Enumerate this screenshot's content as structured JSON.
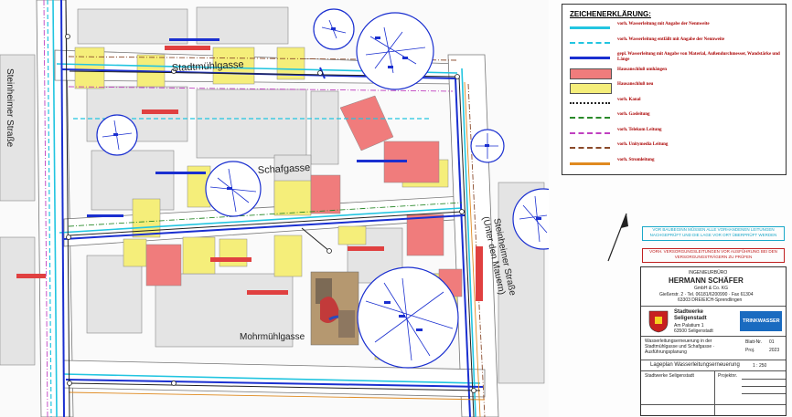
{
  "streets": {
    "stadtmuehlgasse": "Stadtmühlgasse",
    "schafgasse": "Schafgasse",
    "mohrmuehlgasse": "Mohrmühlgasse",
    "steinheimer_left": "Steinheimer Straße",
    "steinheimer_right": "Steinheimer Straße",
    "unter_den_mauern": "(Unter den Mauern)"
  },
  "legend": {
    "title": "ZEICHENERKLÄRUNG:",
    "items": [
      {
        "text": "vorh. Wasserleitung mit Angabe der Nennweite",
        "color": "#22c5e0",
        "style": "solid"
      },
      {
        "text": "vorh. Wasserleitung entfällt mit Angabe der Nennweite",
        "color": "#22c5e0",
        "style": "dashed"
      },
      {
        "text": "gepl. Wasserleitung mit Angabe von Material, Außendurchmesser, Wandstärke und Länge",
        "color": "#1a2fd0",
        "style": "solid"
      },
      {
        "text": "Hausanschluß umhängen",
        "color": "#f07c7c",
        "style": "box"
      },
      {
        "text": "Hausanschluß neu",
        "color": "#f5ee7a",
        "style": "box"
      },
      {
        "text": "vorh. Kanal",
        "color": "#222222",
        "style": "dots"
      },
      {
        "text": "vorh. Gasleitung",
        "color": "#2a8a2a",
        "style": "dashdot"
      },
      {
        "text": "vorh. Telekom Leitung",
        "color": "#c040c0",
        "style": "dashdot"
      },
      {
        "text": "vorh. Unitymedia Leitung",
        "color": "#8a4a2a",
        "style": "dashdot"
      },
      {
        "text": "vorh. Stromleitung",
        "color": "#e08a20",
        "style": "solid"
      }
    ]
  },
  "notes": {
    "cyan_note": "VOR BAUBEGINN MÜSSEN ALLE VORHANDENEN LEITUNGEN NACHGEPRÜFT UND DIE LAGE VOR ORT ÜBERPRÜFT WERDEN",
    "red_note": "VORH. VERSORGUNGSLEITUNGEN VOR AUSFÜHRUNG BEI DEN VERSORGUNGSTRÄGERN ZU PRÜFEN"
  },
  "titleblock": {
    "office_label": "INGENIEURBÜRO",
    "office_name": "HERMANN SCHÄFER",
    "office_sub": "GmbH & Co. KG",
    "office_addr": "Gießerstr. 2 · Tel. 06181/6200990 · Fax 61304",
    "office_city": "63303 DREIEICH-Sprendlingen",
    "client_line1": "Stadtwerke",
    "client_line2": "Seligenstadt",
    "client_addr": "Am Palatium 1",
    "client_city": "63500 Seligenstadt",
    "logo_text": "TRINKWASSER",
    "project": "Wasserleitungserneuerung in der Stadtmühlgasse und Schafgasse · Ausführungsplanung",
    "plan_title": "Lageplan Wasserleitungserneuerung",
    "scale": "1 : 250",
    "sheet_label": "Blatt-Nr.",
    "sheet_no": "01",
    "year_label": "Proj.",
    "year": "2023",
    "field1": "Stadtwerke Seligenstadt",
    "field2": "Projektnr."
  }
}
